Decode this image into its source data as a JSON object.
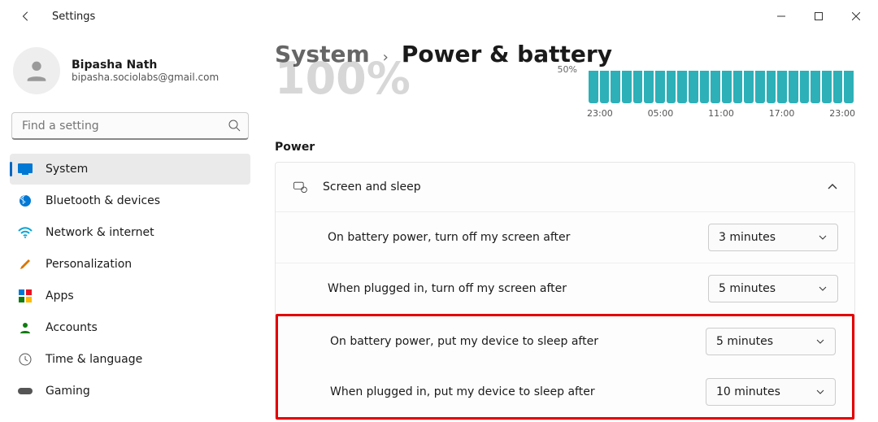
{
  "titlebar": {
    "title": "Settings"
  },
  "profile": {
    "name": "Bipasha Nath",
    "email": "bipasha.sociolabs@gmail.com"
  },
  "search": {
    "placeholder": "Find a setting"
  },
  "nav": {
    "items": [
      {
        "label": "System",
        "active": true
      },
      {
        "label": "Bluetooth & devices"
      },
      {
        "label": "Network & internet"
      },
      {
        "label": "Personalization"
      },
      {
        "label": "Apps"
      },
      {
        "label": "Accounts"
      },
      {
        "label": "Time & language"
      },
      {
        "label": "Gaming"
      }
    ]
  },
  "breadcrumb": {
    "parent": "System",
    "current": "Power & battery"
  },
  "battery": {
    "big_percent": "100%",
    "small_label": "50%",
    "ticks": [
      "23:00",
      "05:00",
      "11:00",
      "17:00",
      "23:00"
    ]
  },
  "sections": {
    "power": {
      "title": "Power",
      "screen_sleep": {
        "header": "Screen and sleep",
        "rows": [
          {
            "label": "On battery power, turn off my screen after",
            "value": "3 minutes"
          },
          {
            "label": "When plugged in, turn off my screen after",
            "value": "5 minutes"
          },
          {
            "label": "On battery power, put my device to sleep after",
            "value": "5 minutes"
          },
          {
            "label": "When plugged in, put my device to sleep after",
            "value": "10 minutes"
          }
        ]
      }
    }
  }
}
